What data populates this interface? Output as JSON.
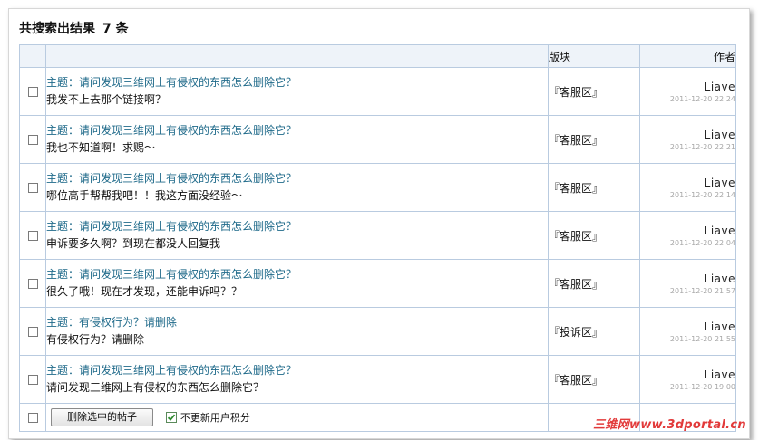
{
  "header": {
    "title": "共搜索出结果",
    "count": "7 条"
  },
  "table": {
    "columns": {
      "board": "版块",
      "author": "作者"
    },
    "rows": [
      {
        "subject": "主题：请问发现三维网上有侵权的东西怎么删除它？",
        "excerpt": "我发不上去那个链接啊？",
        "board": "『客服区』",
        "author": "Liave",
        "date": "2011-12-20 22:24"
      },
      {
        "subject": "主题：请问发现三维网上有侵权的东西怎么删除它？",
        "excerpt": "我也不知道啊！求赐～",
        "board": "『客服区』",
        "author": "Liave",
        "date": "2011-12-20 22:21"
      },
      {
        "subject": "主题：请问发现三维网上有侵权的东西怎么删除它？",
        "excerpt": "哪位高手帮帮我吧！！我这方面没经验～",
        "board": "『客服区』",
        "author": "Liave",
        "date": "2011-12-20 22:14"
      },
      {
        "subject": "主题：请问发现三维网上有侵权的东西怎么删除它？",
        "excerpt": "申诉要多久啊？到现在都没人回复我",
        "board": "『客服区』",
        "author": "Liave",
        "date": "2011-12-20 22:04"
      },
      {
        "subject": "主题：请问发现三维网上有侵权的东西怎么删除它？",
        "excerpt": "很久了哦！现在才发现，还能申诉吗？？",
        "board": "『客服区』",
        "author": "Liave",
        "date": "2011-12-20 21:57"
      },
      {
        "subject": "主题：有侵权行为？请删除",
        "excerpt": "有侵权行为？请删除",
        "board": "『投诉区』",
        "author": "Liave",
        "date": "2011-12-20 21:55"
      },
      {
        "subject": "主题：请问发现三维网上有侵权的东西怎么删除它？",
        "excerpt": "请问发现三维网上有侵权的东西怎么删除它？",
        "board": "『客服区』",
        "author": "Liave",
        "date": "2011-12-20 19:00"
      }
    ]
  },
  "footer": {
    "delete_button": "删除选中的帖子",
    "no_update_points_label": "不更新用户积分",
    "no_update_points_checked": true
  },
  "watermark": "三维网www.3dportal.cn",
  "colors": {
    "subject_link": "#1f6a8a",
    "table_border": "#b9cbe0",
    "header_bg": "#eef3f9",
    "watermark": "#e23a3a"
  }
}
